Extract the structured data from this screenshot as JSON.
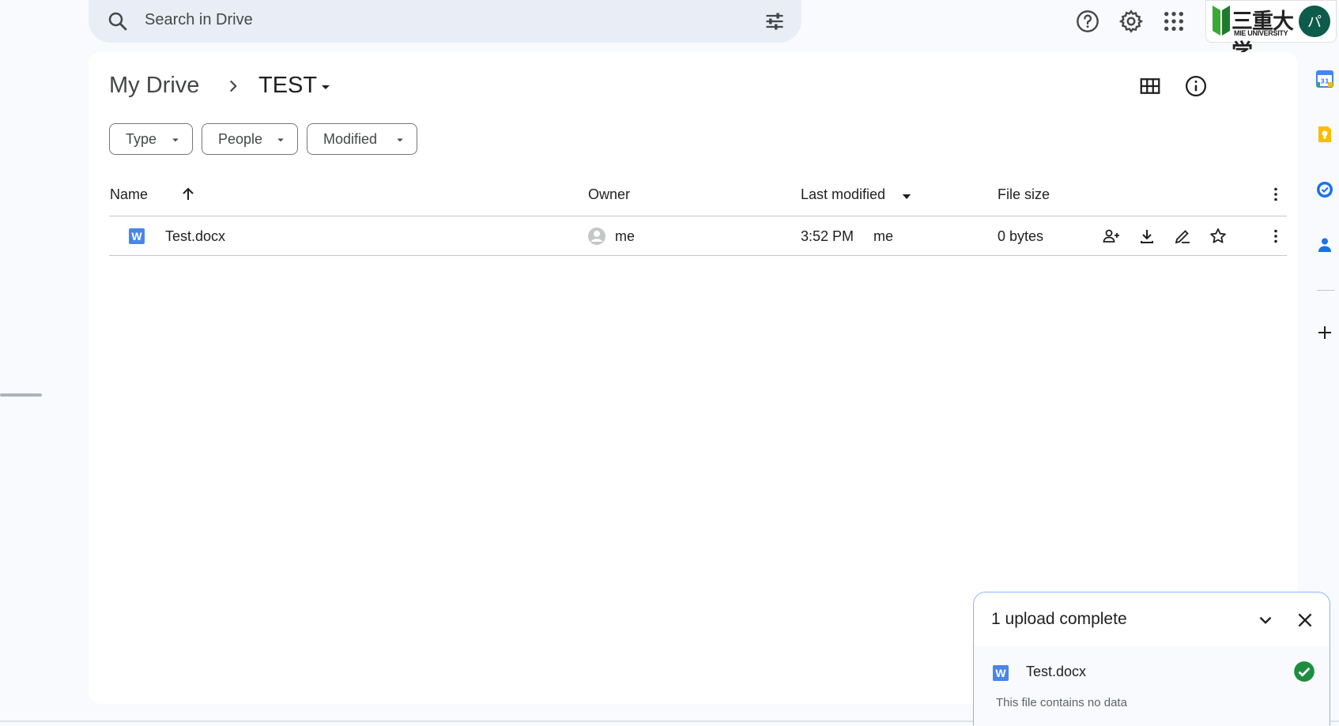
{
  "search": {
    "placeholder": "Search in Drive"
  },
  "header": {
    "icons": [
      "help-icon",
      "settings-icon",
      "apps-grid-icon"
    ],
    "brand": {
      "kanji": "三重大学",
      "text": "MIE UNIVERSITY"
    },
    "avatar_initial": "パ"
  },
  "breadcrumb": {
    "root": "My Drive",
    "current": "TEST"
  },
  "filters": [
    "Type",
    "People",
    "Modified"
  ],
  "table": {
    "columns": {
      "name": "Name",
      "owner": "Owner",
      "modified": "Last modified",
      "size": "File size"
    },
    "rows": [
      {
        "name": "Test.docx",
        "owner": "me",
        "modified_time": "3:52 PM",
        "modified_by": "me",
        "size": "0 bytes",
        "icon_letter": "W"
      }
    ]
  },
  "upload": {
    "title": "1 upload complete",
    "file": "Test.docx",
    "message": "This file contains no data",
    "icon_letter": "W"
  },
  "side_panel": [
    "calendar-icon",
    "keep-icon",
    "tasks-icon",
    "contacts-icon",
    "add-icon"
  ],
  "colors": {
    "accent": "#0b57d0",
    "word": "#4a86e8",
    "success": "#1e8e3e",
    "avatar": "#0d5b4a"
  }
}
